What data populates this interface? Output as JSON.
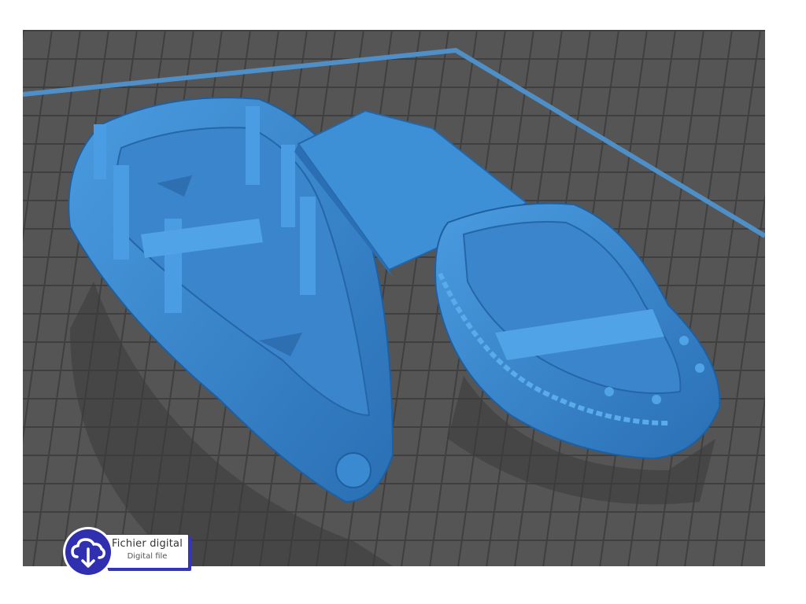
{
  "viewport": {
    "background": "#545454",
    "grid_color": "#3e3e3e",
    "plate_border_color": "#4f8fc8",
    "model_color": "#3d8fd6"
  },
  "models": [
    {
      "name": "large-boat"
    },
    {
      "name": "gangplank"
    },
    {
      "name": "small-boat"
    }
  ],
  "badge": {
    "icon": "cloud-download-icon",
    "primary_label": "Fichier digital",
    "secondary_label": "Digital file",
    "accent": "#2f2fb0"
  }
}
